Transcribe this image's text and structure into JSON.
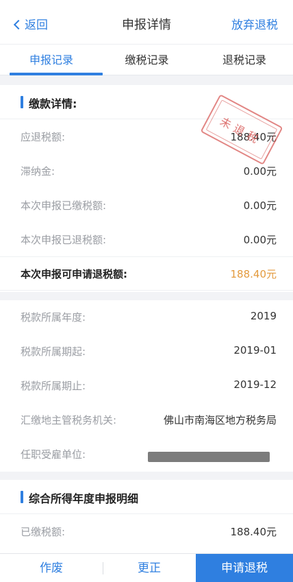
{
  "nav": {
    "back_label": "返回",
    "title": "申报详情",
    "action_label": "放弃退税"
  },
  "tabs": [
    "申报记录",
    "缴税记录",
    "退税记录"
  ],
  "payment": {
    "title": "缴款详情:",
    "rows": [
      {
        "label": "应退税额:",
        "value": "188.40元"
      },
      {
        "label": "滞纳金:",
        "value": "0.00元"
      },
      {
        "label": "本次申报已缴税额:",
        "value": "0.00元"
      },
      {
        "label": "本次申报已退税额:",
        "value": "0.00元"
      }
    ],
    "refundable": {
      "label": "本次申报可申请退税额:",
      "value": "188.40元"
    }
  },
  "stamp_text": "未退税",
  "tax_info": [
    {
      "label": "税款所属年度:",
      "value": "2019"
    },
    {
      "label": "税款所属期起:",
      "value": "2019-01"
    },
    {
      "label": "税款所属期止:",
      "value": "2019-12"
    },
    {
      "label": "汇缴地主管税务机关:",
      "value": "佛山市南海区地方税务局"
    },
    {
      "label": "任职受雇单位:",
      "value": ""
    }
  ],
  "annual": {
    "title": "综合所得年度申报明细",
    "rows": [
      {
        "label": "已缴税额:",
        "value": "188.40元"
      }
    ]
  },
  "footer": {
    "void_label": "作废",
    "correct_label": "更正",
    "refund_label": "申请退税"
  },
  "colors": {
    "accent": "#2f7fe0",
    "highlight": "#e39a3d",
    "stamp": "#d65350"
  }
}
